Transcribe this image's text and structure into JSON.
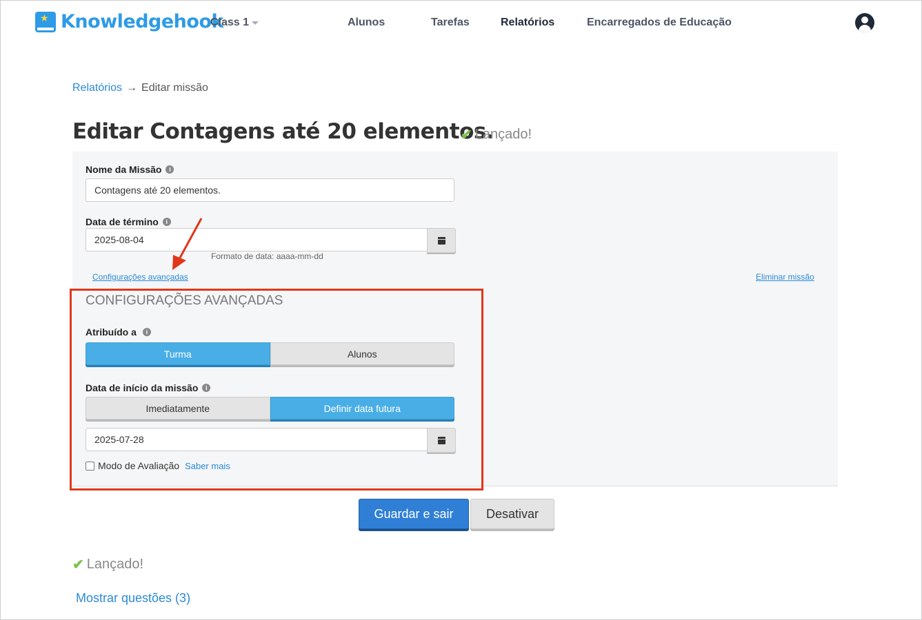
{
  "header": {
    "logo_text": "Knowledgehook",
    "class_selector": "Class 1",
    "nav": [
      "Alunos",
      "Tarefas",
      "Relatórios",
      "Encarregados de Educação"
    ]
  },
  "breadcrumb": {
    "link": "Relatórios",
    "arrow": "→",
    "current": "Editar missão"
  },
  "page": {
    "title": "Editar Contagens até 20 elementos.",
    "status": "Lançado!"
  },
  "form": {
    "mission_name_label": "Nome da Missão",
    "mission_name_value": "Contagens até 20 elementos.",
    "end_date_label": "Data de término",
    "end_date_value": "2025-08-04",
    "date_format_hint": "Formato de data: aaaa-mm-dd",
    "advanced_link": "Configurações avançadas",
    "delete_link": "Eliminar missão",
    "advanced_header": "CONFIGURAÇÕES AVANÇADAS",
    "assigned_label": "Atribuído a",
    "assigned_options": [
      "Turma",
      "Alunos"
    ],
    "assigned_selected": "Turma",
    "start_label": "Data de início da missão",
    "start_options": [
      "Imediatamente",
      "Definir data futura"
    ],
    "start_selected": "Definir data futura",
    "start_date_value": "2025-07-28",
    "eval_mode_label": "Modo de Avaliação",
    "learn_more": "Saber mais"
  },
  "actions": {
    "save": "Guardar e sair",
    "deactivate": "Desativar"
  },
  "footer": {
    "status": "Lançado!",
    "show_questions": "Mostrar questões (3)"
  },
  "colors": {
    "brand": "#2d9be6",
    "accent_blue": "#4aaee6",
    "annotation_red": "#e0371b",
    "success_green": "#7cc24a"
  }
}
